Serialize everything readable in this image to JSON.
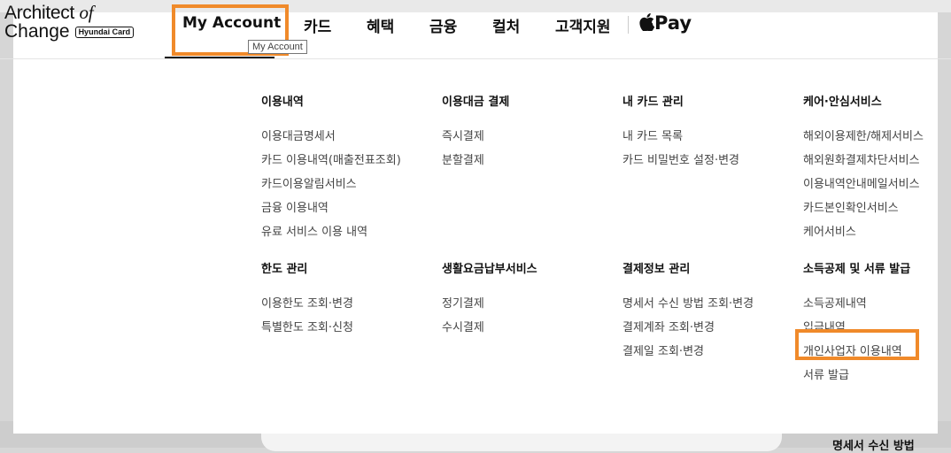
{
  "logo": {
    "line1_main": "Architect ",
    "line1_of": "of",
    "line2_main": "Change",
    "badge": "Hyundai Card"
  },
  "nav": {
    "items": [
      "My Account",
      "카드",
      "혜택",
      "금융",
      "컬처",
      "고객지원"
    ],
    "apple_pay_glyph": "",
    "apple_pay_label": "Pay",
    "tooltip": "My Account"
  },
  "menu": {
    "row1": [
      {
        "heading": "이용내역",
        "links": [
          "이용대금명세서",
          "카드 이용내역(매출전표조회)",
          "카드이용알림서비스",
          "금융 이용내역",
          "유료 서비스 이용 내역"
        ]
      },
      {
        "heading": "이용대금 결제",
        "links": [
          "즉시결제",
          "분할결제"
        ]
      },
      {
        "heading": "내 카드 관리",
        "links": [
          "내 카드 목록",
          "카드 비밀번호 설정·변경"
        ]
      },
      {
        "heading": "케어·안심서비스",
        "links": [
          "해외이용제한/해제서비스",
          "해외원화결제차단서비스",
          "이용내역안내메일서비스",
          "카드본인확인서비스",
          "케어서비스"
        ]
      }
    ],
    "row2": [
      {
        "heading": "한도 관리",
        "links": [
          "이용한도 조회·변경",
          "특별한도 조회·신청"
        ]
      },
      {
        "heading": "생활요금납부서비스",
        "links": [
          "정기결제",
          "수시결제"
        ]
      },
      {
        "heading": "결제정보 관리",
        "links": [
          "명세서 수신 방법 조회·변경",
          "결제계좌 조회·변경",
          "결제일 조회·변경"
        ]
      },
      {
        "heading": "소득공제 및 서류 발급",
        "links": [
          "소득공제내역",
          "입금내역",
          "개인사업자 이용내역",
          "서류 발급"
        ]
      }
    ]
  },
  "background": {
    "side_text": "명세서 수신 방법"
  },
  "colors": {
    "highlight": "#f08a2a",
    "text_primary": "#111111",
    "text_link": "#444444"
  }
}
